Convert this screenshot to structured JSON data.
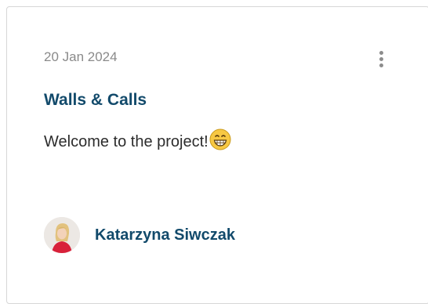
{
  "post": {
    "date": "20 Jan 2024",
    "title": "Walls & Calls",
    "message": "Welcome to the project!",
    "emoji": "grinning-face-emoji",
    "more_icon": "more-vertical-icon"
  },
  "author": {
    "name": "Katarzyna Siwczak",
    "avatar": "avatar-photo"
  },
  "colors": {
    "title": "#124a6b",
    "date": "#8a8a8a",
    "text": "#2c2c2c",
    "border": "#d6d6d6"
  }
}
